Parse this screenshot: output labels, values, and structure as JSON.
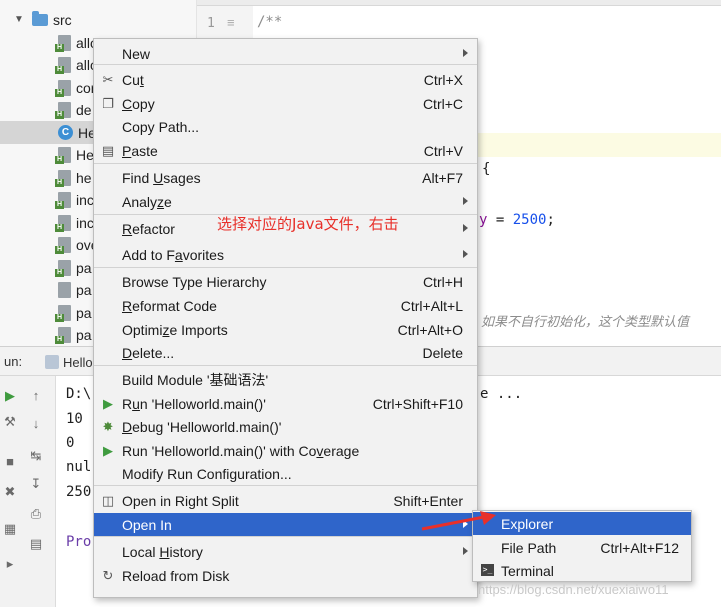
{
  "project_tree": {
    "folder": "src",
    "items": [
      {
        "label": "allo",
        "icon": "java-file-icon"
      },
      {
        "label": "allo",
        "icon": "java-file-icon"
      },
      {
        "label": "cor",
        "icon": "java-file-icon"
      },
      {
        "label": "de",
        "icon": "java-file-icon"
      },
      {
        "label": "He",
        "icon": "class-icon",
        "selected": true
      },
      {
        "label": "He",
        "icon": "java-file-icon"
      },
      {
        "label": "he",
        "icon": "java-file-icon"
      },
      {
        "label": "inc",
        "icon": "java-file-icon"
      },
      {
        "label": "inc",
        "icon": "java-file-icon"
      },
      {
        "label": "ove",
        "icon": "java-file-icon"
      },
      {
        "label": "pa",
        "icon": "java-file-icon"
      },
      {
        "label": "pa",
        "icon": "file-icon"
      },
      {
        "label": "pa",
        "icon": "java-file-icon"
      },
      {
        "label": "pa",
        "icon": "java-file-icon"
      }
    ]
  },
  "editor": {
    "line_number": "1",
    "line1": "/**",
    "brace": "{",
    "assign_var": "y",
    "assign_eq": " = ",
    "assign_num": "2500",
    "assign_end": ";",
    "chinese_comment": "如果不自行初始化，这个类型默认值"
  },
  "run_panel": {
    "label": "un:",
    "tab": "Hello",
    "console_lines": [
      "D:\\",
      "10",
      "0",
      "nul",
      "250",
      "",
      "Pro"
    ],
    "ellipsis": "e ..."
  },
  "context_menu": {
    "items": [
      {
        "label": "New",
        "submenu": true
      },
      {
        "label": "Cut",
        "mnemonic": "t",
        "shortcut": "Ctrl+X",
        "icon": "cut-icon"
      },
      {
        "label": "Copy",
        "mnemonic": "C",
        "shortcut": "Ctrl+C",
        "icon": "copy-icon"
      },
      {
        "label": "Copy Path...",
        "shortcut": ""
      },
      {
        "label": "Paste",
        "mnemonic": "P",
        "shortcut": "Ctrl+V",
        "icon": "paste-icon"
      },
      {
        "label": "Find Usages",
        "mnemonic": "U",
        "shortcut": "Alt+F7"
      },
      {
        "label": "Analyze",
        "mnemonic": "z",
        "submenu": true
      },
      {
        "label": "Refactor",
        "mnemonic": "R",
        "submenu": true
      },
      {
        "label": "Add to Favorites",
        "mnemonic": "a",
        "submenu": true
      },
      {
        "label": "Browse Type Hierarchy",
        "shortcut": "Ctrl+H"
      },
      {
        "label": "Reformat Code",
        "mnemonic": "R",
        "shortcut": "Ctrl+Alt+L"
      },
      {
        "label": "Optimize Imports",
        "mnemonic": "z",
        "shortcut": "Ctrl+Alt+O"
      },
      {
        "label": "Delete...",
        "mnemonic": "D",
        "shortcut": "Delete"
      },
      {
        "label": "Build Module '基础语法'",
        "shortcut": ""
      },
      {
        "label": "Run 'Helloworld.main()'",
        "mnemonic": "u",
        "shortcut": "Ctrl+Shift+F10",
        "icon": "run-icon"
      },
      {
        "label": "Debug 'Helloworld.main()'",
        "mnemonic": "D",
        "shortcut": "",
        "icon": "debug-icon"
      },
      {
        "label": "Run 'Helloworld.main()' with Coverage",
        "mnemonic": "v",
        "shortcut": "",
        "icon": "coverage-icon"
      },
      {
        "label": "Modify Run Configuration...",
        "shortcut": ""
      },
      {
        "label": "Open in Right Split",
        "shortcut": "Shift+Enter",
        "icon": "split-icon"
      },
      {
        "label": "Open In",
        "submenu": true,
        "active": true
      },
      {
        "label": "Local History",
        "mnemonic": "H",
        "submenu": true
      },
      {
        "label": "Reload from Disk",
        "shortcut": "",
        "icon": "reload-icon"
      }
    ]
  },
  "submenu": {
    "items": [
      {
        "label": "Explorer",
        "shortcut": "",
        "active": true
      },
      {
        "label": "File Path",
        "mnemonic": "P",
        "shortcut": "Ctrl+Alt+F12"
      },
      {
        "label": "Terminal",
        "shortcut": "",
        "icon": "terminal-icon"
      }
    ]
  },
  "annotation": "选择对应的Java文件，右击",
  "watermark": "https://blog.csdn.net/xuexiaiwo11",
  "colors": {
    "accent": "#2f65ca",
    "annotation": "#e8302a",
    "menu_bg": "#f2f2f2",
    "code_number": "#1750eb"
  }
}
